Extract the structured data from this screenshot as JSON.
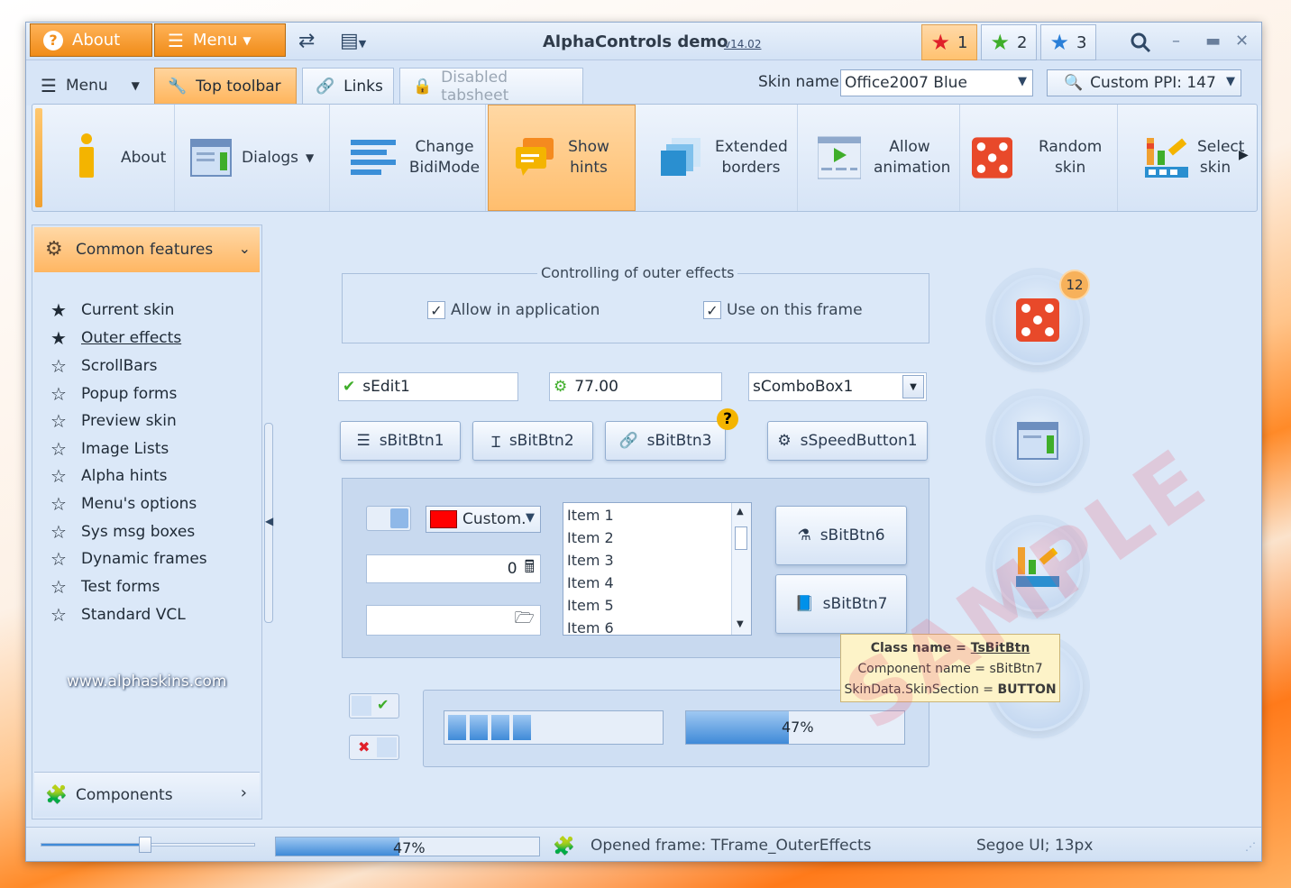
{
  "titlebar": {
    "about": "About",
    "menu": "Menu",
    "title": "AlphaControls demo",
    "version": "v14.02",
    "stars": [
      "1",
      "2",
      "3"
    ]
  },
  "tabs": {
    "menu": "Menu",
    "items": [
      "Top toolbar",
      "Links",
      "Disabled tabsheet"
    ],
    "skin_label": "Skin name:",
    "skin_value": "Office2007 Blue",
    "ppi": "Custom PPI: 147"
  },
  "ribbon": {
    "items": [
      "About",
      "Dialogs",
      "Change BidiMode",
      "Show hints",
      "Extended borders",
      "Allow animation",
      "Random skin",
      "Select skin"
    ]
  },
  "sidebar": {
    "header": "Common features",
    "items": [
      "Current skin",
      "Outer effects",
      "ScrollBars",
      "Popup forms",
      "Preview skin",
      "Image Lists",
      "Alpha hints",
      "Menu's options",
      "Sys msg boxes",
      "Dynamic frames",
      "Test forms",
      "Standard VCL"
    ],
    "url": "www.alphaskins.com",
    "footer": "Components"
  },
  "main": {
    "group_title": "Controlling of outer effects",
    "check1": "Allow in application",
    "check2": "Use on this frame",
    "edit1": "sEdit1",
    "spin": "77.00",
    "combo": "sComboBox1",
    "buttons": [
      "sBitBtn1",
      "sBitBtn2",
      "sBitBtn3",
      "sSpeedButton1"
    ],
    "color_combo": "Custom.",
    "calc_value": "0",
    "list_items": [
      "Item 1",
      "Item 2",
      "Item 3",
      "Item 4",
      "Item 5",
      "Item 6"
    ],
    "btn6": "sBitBtn6",
    "btn7": "sBitBtn7",
    "progress_label": "47%",
    "badge": "12"
  },
  "hint": {
    "line1_label": "Class name = ",
    "line1_value": "TsBitBtn",
    "line2": "Component name = sBitBtn7",
    "line3_label": "SkinData.SkinSection = ",
    "line3_value": "BUTTON"
  },
  "status": {
    "progress": "47%",
    "frame": "Opened frame: TFrame_OuterEffects",
    "font": "Segoe UI; 13px"
  },
  "watermark": "SAMPLE",
  "colors": {
    "accent_orange": "#f08c18",
    "window_bg": "#dbe8f8"
  }
}
